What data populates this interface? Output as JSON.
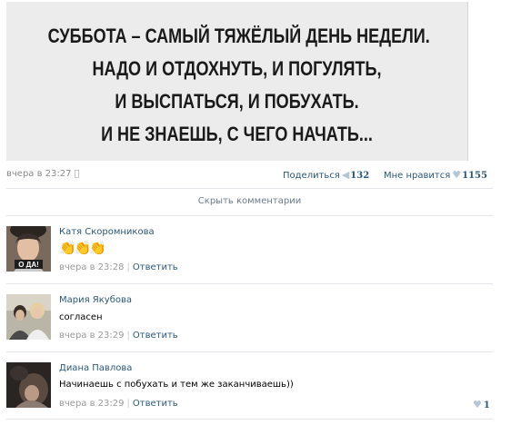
{
  "post": {
    "image_lines": [
      "СУББОТА – САМЫЙ ТЯЖЁЛЫЙ ДЕНЬ НЕДЕЛИ.",
      "НАДО И ОТДОХНУТЬ, И ПОГУЛЯТЬ,",
      "И ВЫСПАТЬСЯ, И ПОБУХАТЬ.",
      "И НЕ ЗНАЕШЬ, С ЧЕГО НАЧАТЬ..."
    ],
    "date": "вчера в 23:27",
    "share_label": "Поделиться",
    "share_count": "132",
    "like_label": "Мне нравится",
    "like_count": "1155"
  },
  "hide_comments_label": "Скрыть комментарии",
  "comments": [
    {
      "name": "Катя Скоромникова",
      "text": "👏👏👏",
      "date": "вчера в 23:28",
      "reply_label": "Ответить",
      "avatar_caption": "О ДА!",
      "likes": ""
    },
    {
      "name": "Мария Якубова",
      "text": "согласен",
      "date": "вчера в 23:29",
      "reply_label": "Ответить",
      "likes": ""
    },
    {
      "name": "Диана Павлова",
      "text": "Начинаешь с побухать и тем же заканчиваешь))",
      "date": "вчера в 23:29",
      "reply_label": "Ответить",
      "likes": "1"
    }
  ],
  "icons": {
    "apple": "apple-icon",
    "share": "megaphone-icon",
    "like": "heart-icon"
  },
  "colors": {
    "link": "#2b587a",
    "muted": "#999999",
    "icon": "#b4c5d6"
  }
}
